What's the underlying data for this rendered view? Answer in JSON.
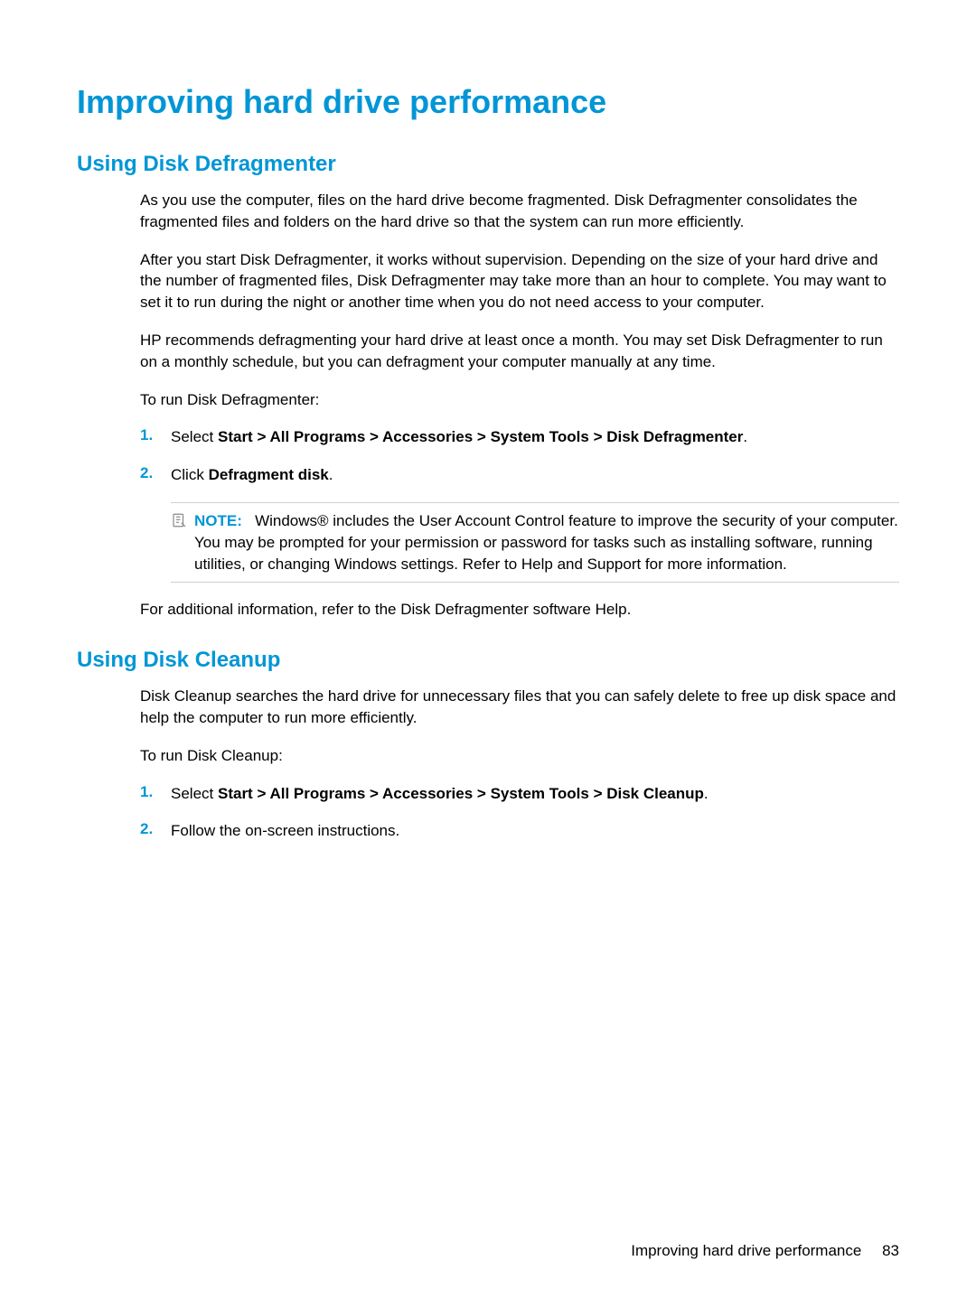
{
  "h1": "Improving hard drive performance",
  "section1": {
    "heading": "Using Disk Defragmenter",
    "p1": "As you use the computer, files on the hard drive become fragmented. Disk Defragmenter consolidates the fragmented files and folders on the hard drive so that the system can run more efficiently.",
    "p2": "After you start Disk Defragmenter, it works without supervision. Depending on the size of your hard drive and the number of fragmented files, Disk Defragmenter may take more than an hour to complete. You may want to set it to run during the night or another time when you do not need access to your computer.",
    "p3": "HP recommends defragmenting your hard drive at least once a month. You may set Disk Defragmenter to run on a monthly schedule, but you can defragment your computer manually at any time.",
    "p4": "To run Disk Defragmenter:",
    "steps": [
      {
        "num": "1.",
        "prefix": "Select ",
        "bold": "Start > All Programs > Accessories > System Tools > Disk Defragmenter",
        "suffix": "."
      },
      {
        "num": "2.",
        "prefix": "Click ",
        "bold": "Defragment disk",
        "suffix": "."
      }
    ],
    "note": {
      "label": "NOTE:",
      "text": "Windows® includes the User Account Control feature to improve the security of your computer. You may be prompted for your permission or password for tasks such as installing software, running utilities, or changing Windows settings. Refer to Help and Support for more information."
    },
    "p5": "For additional information, refer to the Disk Defragmenter software Help."
  },
  "section2": {
    "heading": "Using Disk Cleanup",
    "p1": "Disk Cleanup searches the hard drive for unnecessary files that you can safely delete to free up disk space and help the computer to run more efficiently.",
    "p2": "To run Disk Cleanup:",
    "steps": [
      {
        "num": "1.",
        "prefix": "Select ",
        "bold": "Start > All Programs > Accessories > System Tools > Disk Cleanup",
        "suffix": "."
      },
      {
        "num": "2.",
        "prefix": "Follow the on-screen instructions.",
        "bold": "",
        "suffix": ""
      }
    ]
  },
  "footer": {
    "text": "Improving hard drive performance",
    "page_num": "83"
  }
}
